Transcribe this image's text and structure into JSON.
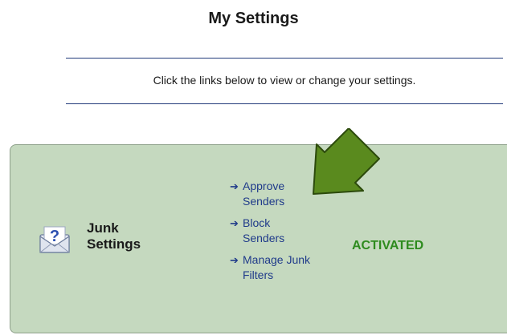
{
  "page": {
    "title": "My Settings",
    "instructions": "Click the links below to view or change your settings."
  },
  "junk_settings": {
    "title_line1": "Junk",
    "title_line2": "Settings",
    "status": "ACTIVATED",
    "links": [
      {
        "line1": "Approve",
        "line2": "Senders"
      },
      {
        "line1": "Block",
        "line2": "Senders"
      },
      {
        "line1": "Manage Junk",
        "line2": "Filters"
      }
    ]
  },
  "icons": {
    "link_arrow": "right-arrow-icon",
    "settings_icon": "envelope-question-icon",
    "annotation": "pointer-arrow-icon"
  },
  "colors": {
    "panel_bg": "#c5d9bf",
    "link": "#1f3a8a",
    "status": "#2e8b1e",
    "rule": "#213a7a",
    "pointer_arrow": "#5a8a1e"
  }
}
